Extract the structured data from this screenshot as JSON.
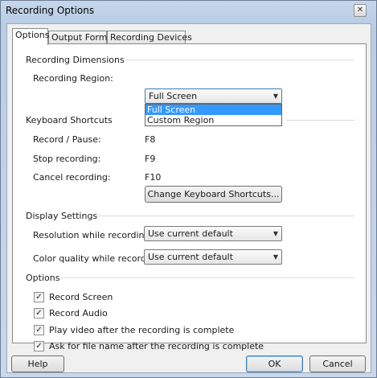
{
  "window": {
    "title": "Recording Options",
    "close_glyph": "✕"
  },
  "tabs": [
    {
      "label": "Options",
      "active": true
    },
    {
      "label": "Output Format",
      "active": false
    },
    {
      "label": "Recording Devices",
      "active": false
    }
  ],
  "recording_dimensions": {
    "group_title": "Recording Dimensions",
    "region_label": "Recording Region:",
    "region_value": "Full Screen",
    "region_options": [
      "Full Screen",
      "Custom Region"
    ],
    "highlighted_option": "Full Screen"
  },
  "keyboard_shortcuts": {
    "group_title": "Keyboard Shortcuts",
    "items": [
      {
        "label": "Record / Pause:",
        "key": "F8"
      },
      {
        "label": "Stop recording:",
        "key": "F9"
      },
      {
        "label": "Cancel recording:",
        "key": "F10"
      }
    ],
    "change_button": "Change Keyboard Shortcuts..."
  },
  "display_settings": {
    "group_title": "Display Settings",
    "resolution_label": "Resolution while recording:",
    "resolution_value": "Use current default",
    "color_label": "Color quality while recording:",
    "color_value": "Use current default"
  },
  "options": {
    "group_title": "Options",
    "checkboxes": [
      {
        "label": "Record Screen",
        "checked": true
      },
      {
        "label": "Record Audio",
        "checked": true
      },
      {
        "label": "Play video after the recording is complete",
        "checked": true
      },
      {
        "label": "Ask for file name after the recording is complete",
        "checked": true
      }
    ]
  },
  "footer": {
    "help": "Help",
    "ok": "OK",
    "cancel": "Cancel"
  },
  "icons": {
    "dropdown_arrow": "▼",
    "checkmark": "✓"
  },
  "colors": {
    "selection": "#3399ff",
    "focus_border": "#3c7fb1",
    "title_bar": "#b9cde6"
  }
}
